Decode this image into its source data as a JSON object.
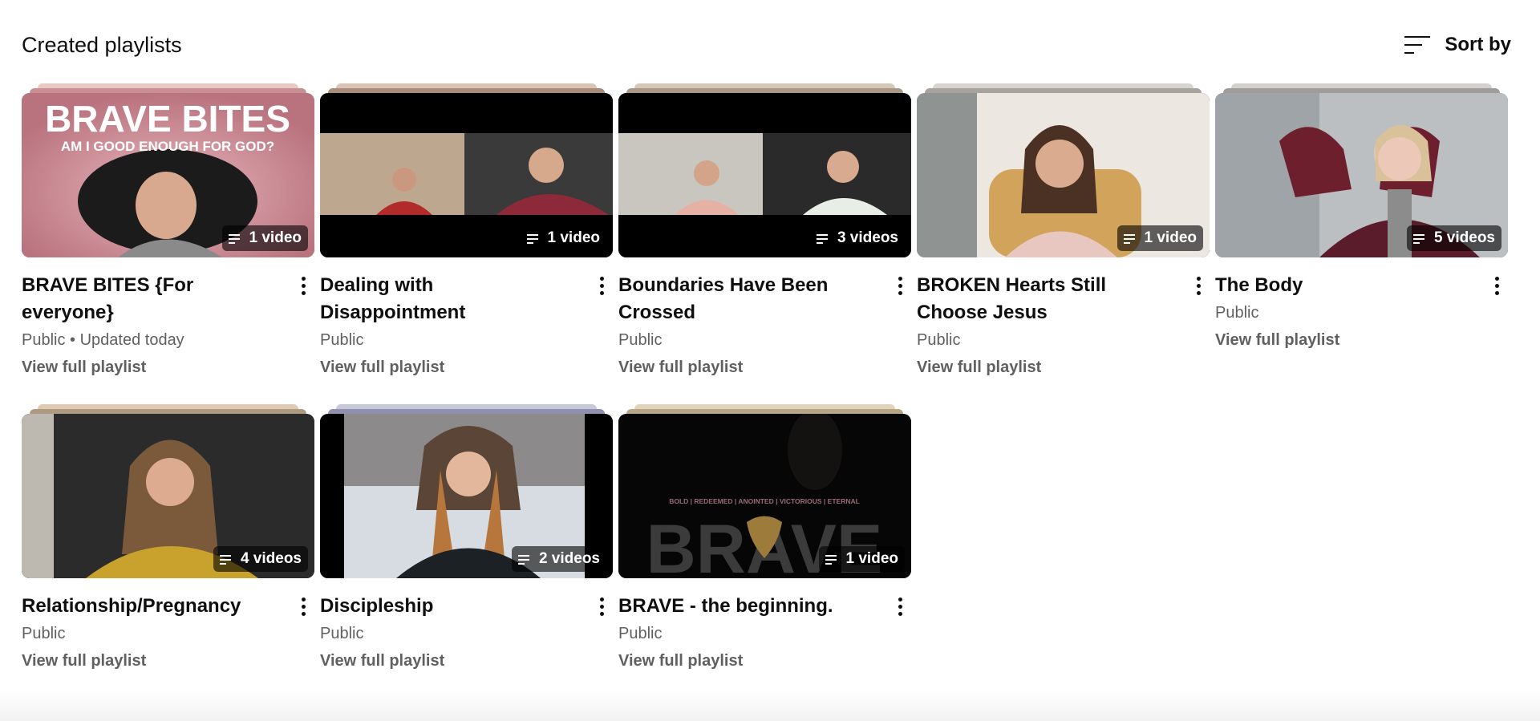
{
  "section_title": "Created playlists",
  "sort_label": "Sort by",
  "sort_icon": "sort-lines-icon",
  "playlists": [
    {
      "title": "BRAVE BITES {For everyone}",
      "status": "Public • Updated today",
      "count": "1 video",
      "view": "View full playlist",
      "thumb_text_1": "BRAVE BITES",
      "thumb_text_2": "AM I GOOD ENOUGH FOR GOD?"
    },
    {
      "title": "Dealing with Disappointment",
      "status": "Public",
      "count": "1 video",
      "view": "View full playlist"
    },
    {
      "title": "Boundaries Have Been Crossed",
      "status": "Public",
      "count": "3 videos",
      "view": "View full playlist"
    },
    {
      "title": "BROKEN Hearts Still Choose Jesus",
      "status": "Public",
      "count": "1 video",
      "view": "View full playlist"
    },
    {
      "title": "The Body",
      "status": "Public",
      "count": "5 videos",
      "view": "View full playlist"
    },
    {
      "title": "Relationship/Pregnancy",
      "status": "Public",
      "count": "4 videos",
      "view": "View full playlist"
    },
    {
      "title": "Discipleship",
      "status": "Public",
      "count": "2 videos",
      "view": "View full playlist"
    },
    {
      "title": "BRAVE - the beginning.",
      "status": "Public",
      "count": "1 video",
      "view": "View full playlist",
      "thumb_text_1": "BOLD | REDEEMED | ANOINTED | VICTORIOUS | ETERNAL",
      "thumb_text_2": "BRAVE"
    }
  ],
  "colors": {
    "text_primary": "#0f0f0f",
    "text_secondary": "#606060",
    "badge_bg": "rgba(0,0,0,0.6)"
  }
}
